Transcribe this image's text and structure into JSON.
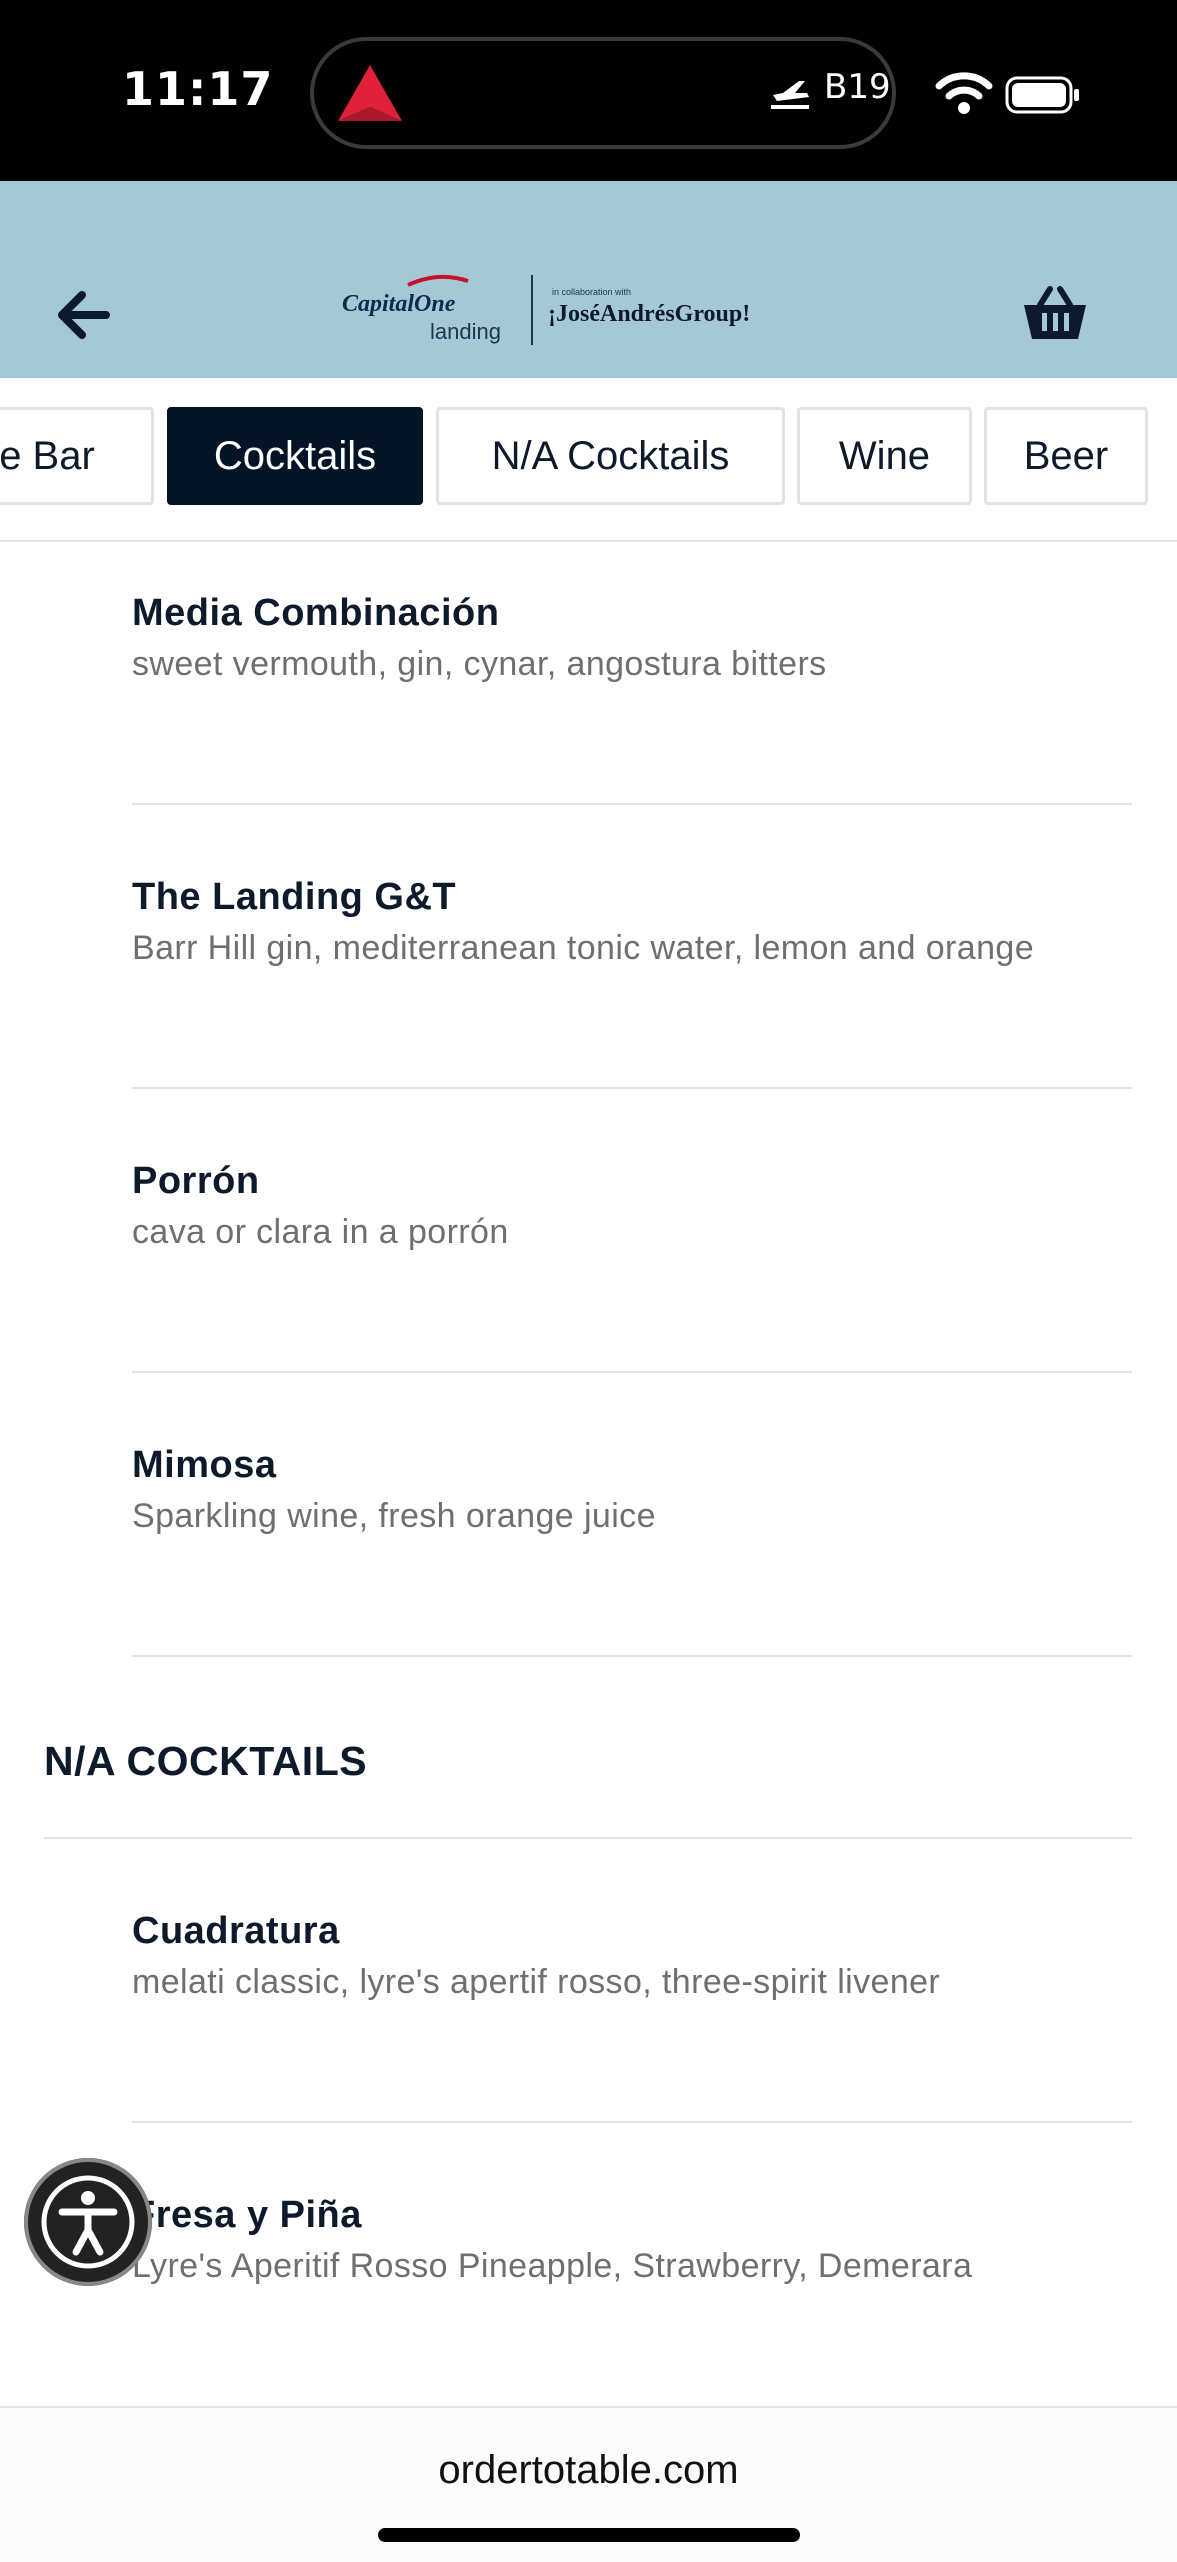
{
  "status_bar": {
    "time": "11:17",
    "island_app_icon": "delta-airline-logo-icon",
    "gate": "B19",
    "icons": [
      "plane-departure-icon",
      "wifi-icon",
      "battery-icon"
    ]
  },
  "header": {
    "back_icon": "arrow-left-icon",
    "logo": {
      "brand": "CapitalOne",
      "sub": "landing",
      "collab": "in collaboration with",
      "group": "JoséAndrésGroup"
    },
    "basket_icon": "basket-icon",
    "bg_color": "#a4c9d4"
  },
  "tabs": [
    {
      "label": "e Bar",
      "active": false
    },
    {
      "label": "Cocktails",
      "active": true
    },
    {
      "label": "N/A Cocktails",
      "active": false
    },
    {
      "label": "Wine",
      "active": false
    },
    {
      "label": "Beer",
      "active": false
    }
  ],
  "menu": {
    "items": [
      {
        "name": "Media Combinación",
        "description": "sweet vermouth, gin, cynar, angostura bitters"
      },
      {
        "name": "The Landing G&T",
        "description": "Barr Hill gin, mediterranean tonic water, lemon and orange"
      },
      {
        "name": "Porrón",
        "description": "cava or clara in a porrón"
      },
      {
        "name": "Mimosa",
        "description": "Sparkling wine, fresh orange juice"
      }
    ],
    "na_section": {
      "heading": "N/A COCKTAILS",
      "items": [
        {
          "name": "Cuadratura",
          "description": "melati classic, lyre's apertif rosso, three-spirit livener"
        },
        {
          "name": "Fresa y Piña",
          "description": "Lyre's Aperitif Rosso Pineapple, Strawberry, Demerara"
        }
      ]
    }
  },
  "accessibility": {
    "icon": "accessibility-icon"
  },
  "browser": {
    "url": "ordertotable.com"
  },
  "colors": {
    "active_tab": "#051326",
    "text": "#0d1a2c",
    "muted": "#6f6f6f"
  }
}
